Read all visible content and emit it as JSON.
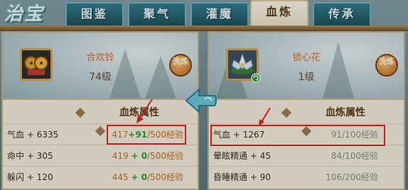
{
  "title": "治宝",
  "tabs": [
    {
      "label": "图鉴"
    },
    {
      "label": "聚气"
    },
    {
      "label": "灌魔"
    },
    {
      "label": "血炼",
      "active": true
    },
    {
      "label": "传承"
    }
  ],
  "left": {
    "item_name": "合欢铃",
    "level": "74级",
    "wash_button": "洗炼",
    "section_title": "血炼属性",
    "rows": [
      {
        "label": "气血 + 6335",
        "current": "417",
        "bonus": "+91",
        "max": "/500经验"
      },
      {
        "label": "命中 + 305",
        "current": "419",
        "bonus": "+ 0",
        "max": "/500经验"
      },
      {
        "label": "躲闪 + 120",
        "current": "445",
        "bonus": "+ 0",
        "max": "/500经验"
      }
    ]
  },
  "right": {
    "item_name": "锁心花",
    "level": "1级",
    "wash_button": "洗炼",
    "section_title": "血炼属性",
    "rows": [
      {
        "label": "气血 + 1267",
        "value": "91/100经验"
      },
      {
        "label": "晕眩精通 + 45",
        "value": "84/100经验"
      },
      {
        "label": "昏睡精通 + 90",
        "value": "106/200经验"
      }
    ]
  },
  "colors": {
    "highlight": "#e02020",
    "bonus_green": "#2e9a2e",
    "exp_orange": "#c5681e"
  }
}
